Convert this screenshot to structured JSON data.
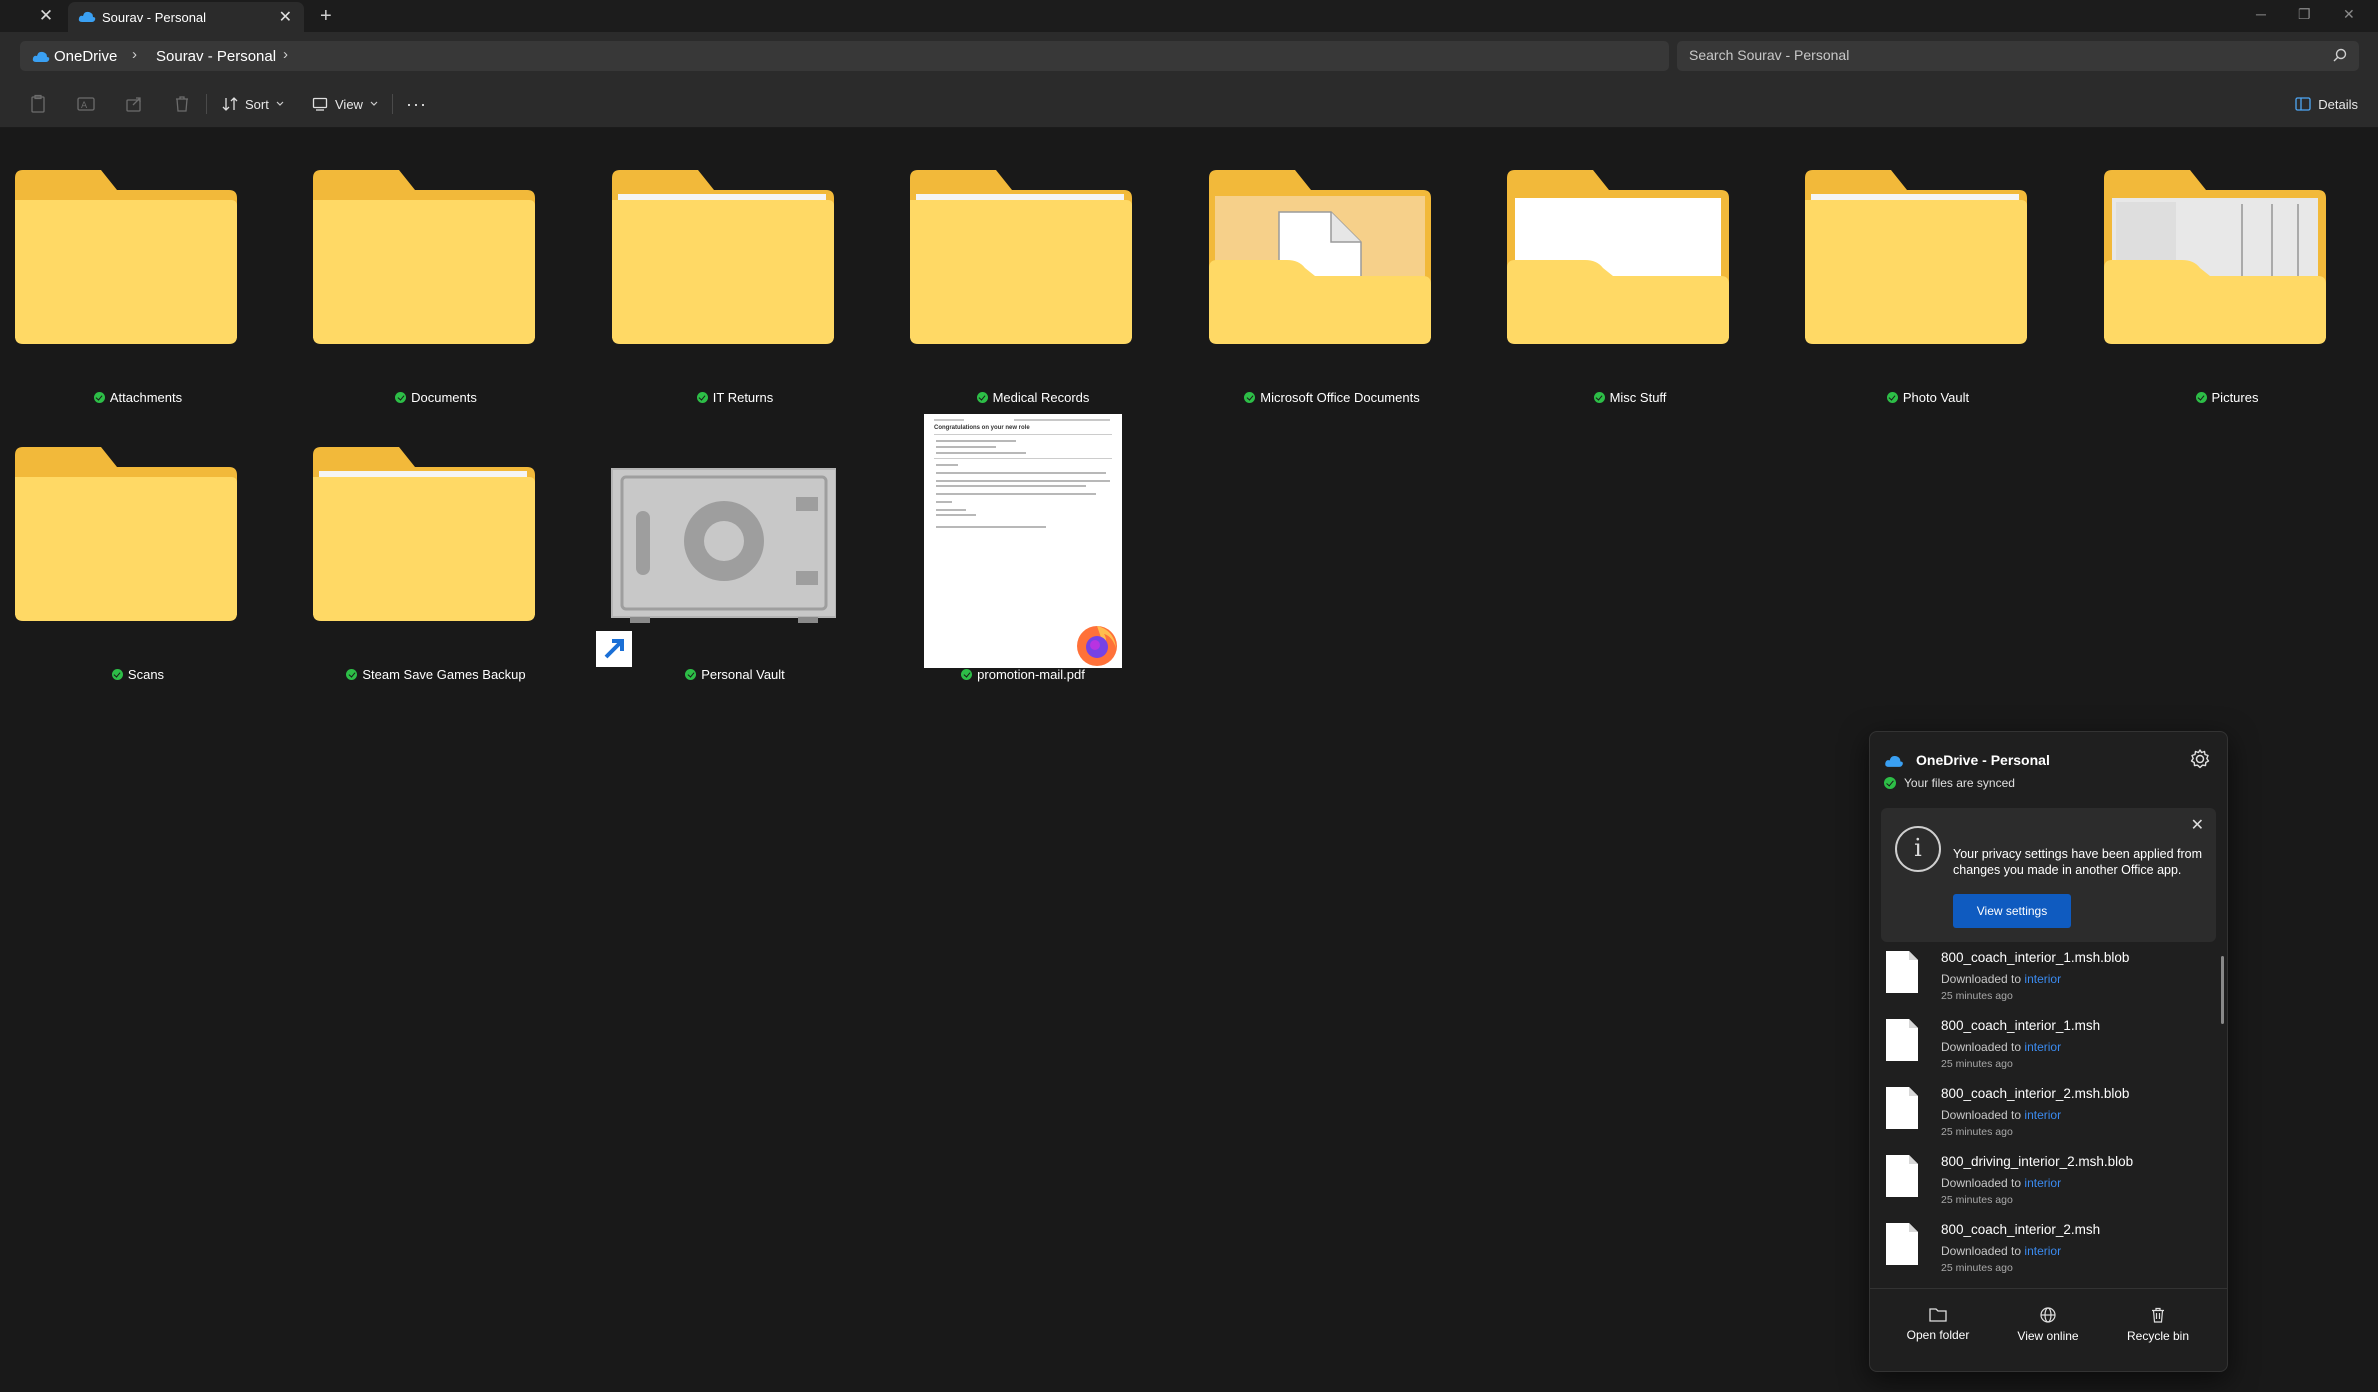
{
  "window": {
    "tab_title": "Sourav - Personal",
    "new_tab_symbol": "+",
    "close_symbol": "✕"
  },
  "address": {
    "root": "OneDrive",
    "current": "Sourav - Personal",
    "search_placeholder": "Search Sourav - Personal"
  },
  "commands": {
    "sort_label": "Sort",
    "view_label": "View",
    "more_label": "···",
    "details_label": "Details"
  },
  "items": [
    {
      "name": "Attachments",
      "type": "folder"
    },
    {
      "name": "Documents",
      "type": "folder"
    },
    {
      "name": "IT Returns",
      "type": "folder"
    },
    {
      "name": "Medical Records",
      "type": "folder"
    },
    {
      "name": "Microsoft Office Documents",
      "type": "folder"
    },
    {
      "name": "Misc Stuff",
      "type": "folder"
    },
    {
      "name": "Photo Vault",
      "type": "folder"
    },
    {
      "name": "Pictures",
      "type": "folder"
    },
    {
      "name": "Scans",
      "type": "folder"
    },
    {
      "name": "Steam Save Games Backup",
      "type": "folder"
    },
    {
      "name": "Personal Vault",
      "type": "vault"
    },
    {
      "name": "promotion-mail.pdf",
      "type": "pdf"
    }
  ],
  "pdf_preview": {
    "heading": "Congratulations on your new role"
  },
  "flyout": {
    "title": "OneDrive - Personal",
    "status": "Your files are synced",
    "notice_text": "Your privacy settings have been applied from changes you made in another Office app.",
    "notice_button": "View settings",
    "files": [
      {
        "name": "800_coach_interior_1.msh.blob",
        "action": "Downloaded to",
        "folder": "interior",
        "time": "25 minutes ago"
      },
      {
        "name": "800_coach_interior_1.msh",
        "action": "Downloaded to",
        "folder": "interior",
        "time": "25 minutes ago"
      },
      {
        "name": "800_coach_interior_2.msh.blob",
        "action": "Downloaded to",
        "folder": "interior",
        "time": "25 minutes ago"
      },
      {
        "name": "800_driving_interior_2.msh.blob",
        "action": "Downloaded to",
        "folder": "interior",
        "time": "25 minutes ago"
      },
      {
        "name": "800_coach_interior_2.msh",
        "action": "Downloaded to",
        "folder": "interior",
        "time": "25 minutes ago"
      }
    ],
    "footer": {
      "open_folder": "Open folder",
      "view_online": "View online",
      "recycle_bin": "Recycle bin"
    }
  },
  "colors": {
    "folder_back": "#f2b93a",
    "folder_front": "#ffd965",
    "sync_green": "#2dbe47",
    "accent_blue": "#0f5bc0",
    "link_blue": "#3b8bf0"
  }
}
